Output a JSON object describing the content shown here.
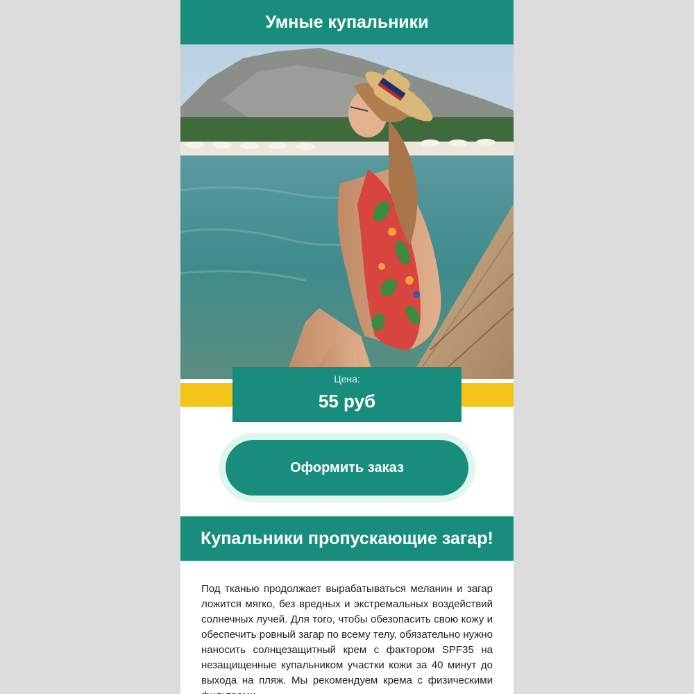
{
  "header": {
    "title": "Умные купальники"
  },
  "hero": {
    "image": "woman-in-swimsuit-on-pier-photo"
  },
  "price": {
    "label": "Цена:",
    "value": "55 руб"
  },
  "order": {
    "button_label": "Оформить заказ"
  },
  "section": {
    "title": "Купальники пропускающие загар!",
    "paragraph": "Под тканью продолжает вырабатываться меланин и загар ложится мягко, без вредных и экстремальных воздействий солнечных лучей. Для того, чтобы обезопасить свою кожу и обеспечить ровный загар по всему телу, обязательно нужно наносить солнцезащитный крем с фактором SPF35 на незащищенные купальником участки кожи за 40 минут до выхода на пляж. Мы рекомендуем крема с физическими фильтрами."
  },
  "colors": {
    "teal": "#198d7d",
    "yellow": "#f4c518",
    "mint": "#ddf7ee",
    "background": "#dcdcdc"
  }
}
